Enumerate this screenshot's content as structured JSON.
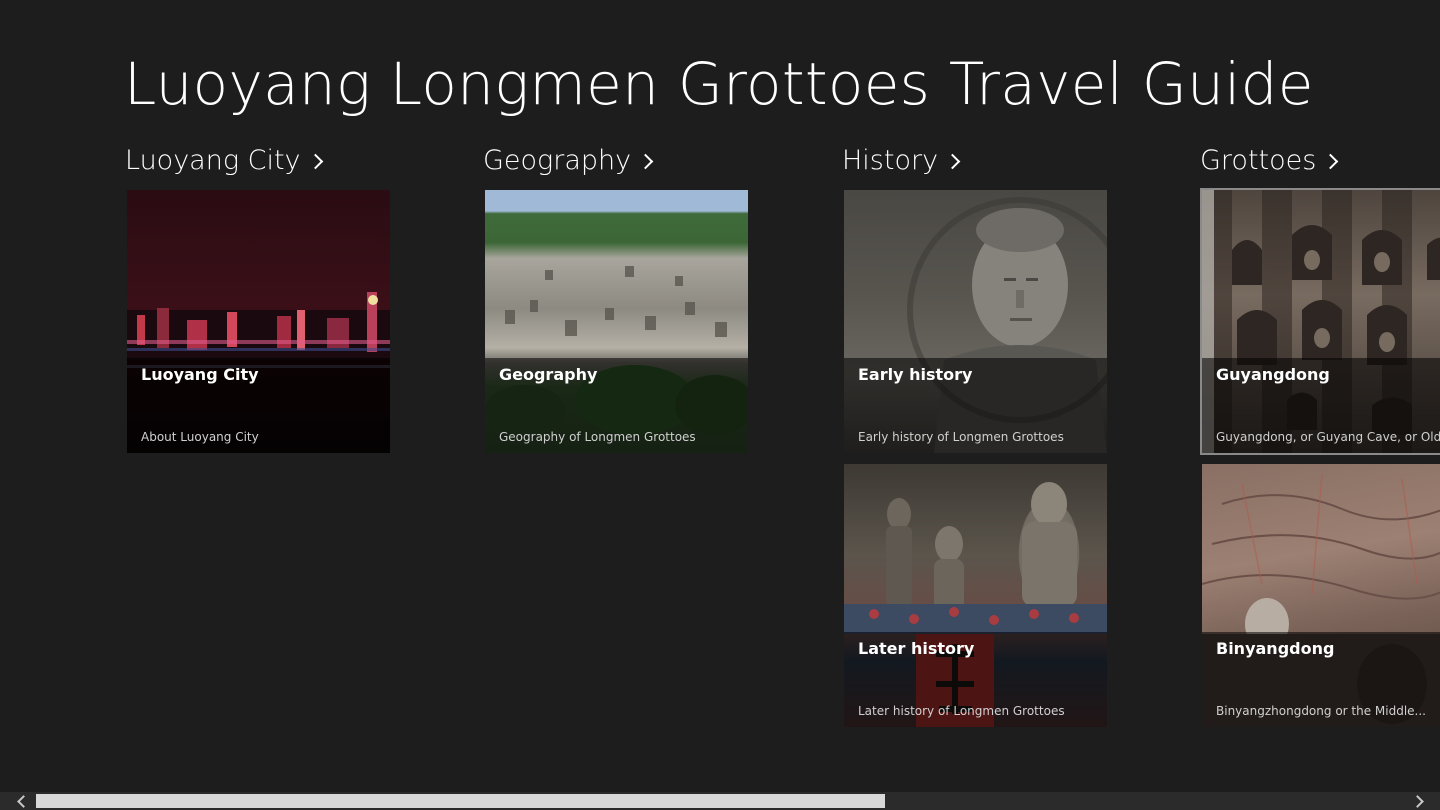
{
  "app": {
    "title": "Luoyang Longmen Grottoes Travel Guide"
  },
  "groups": [
    {
      "header": "Luoyang City",
      "items": [
        {
          "title": "Luoyang City",
          "subtitle": "About Luoyang City"
        }
      ]
    },
    {
      "header": "Geography",
      "items": [
        {
          "title": "Geography",
          "subtitle": "Geography of Longmen Grottoes"
        }
      ]
    },
    {
      "header": "History",
      "items": [
        {
          "title": "Early history",
          "subtitle": "Early history of Longmen Grottoes"
        },
        {
          "title": "Later history",
          "subtitle": "Later history of Longmen Grottoes"
        }
      ]
    },
    {
      "header": "Grottoes",
      "items": [
        {
          "title": "Guyangdong",
          "subtitle": "Guyangdong, or Guyang Cave, or Old..."
        },
        {
          "title": "Binyangdong",
          "subtitle": "Binyangzhongdong or the Middle..."
        }
      ]
    }
  ],
  "icons": {
    "group_chevron": "chevron-right-icon",
    "scroll_left": "chevron-left-icon",
    "scroll_right": "chevron-right-icon"
  },
  "colors": {
    "background": "#1d1d1d",
    "text": "#ffffff",
    "scrollbar_track": "#2b2b2b",
    "scrollbar_thumb": "#d9d9d9"
  }
}
